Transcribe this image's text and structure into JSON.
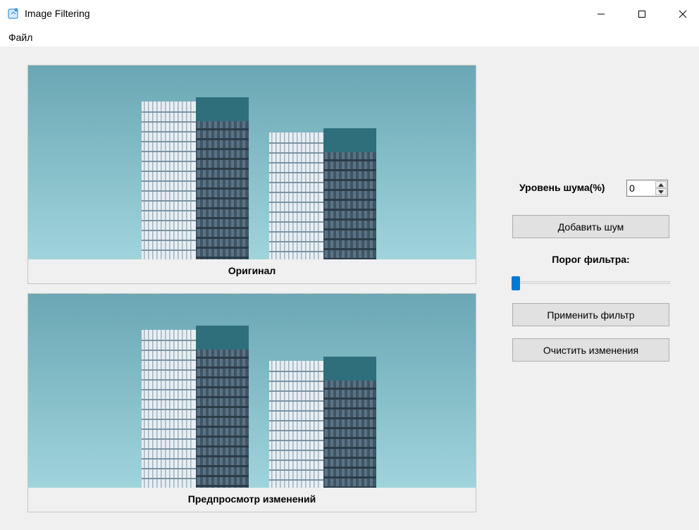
{
  "window": {
    "title": "Image Filtering",
    "icon": "app-image-icon"
  },
  "window_controls": {
    "minimize_icon": "minimize-icon",
    "maximize_icon": "maximize-icon",
    "close_icon": "close-icon"
  },
  "menu": {
    "items": [
      {
        "label": "Файл"
      }
    ]
  },
  "images": {
    "original": {
      "caption": "Оригинал"
    },
    "preview": {
      "caption": "Предпросмотр изменений"
    }
  },
  "controls": {
    "noise_label": "Уровень шума(%)",
    "noise_value": "0",
    "add_noise_button": "Добавить шум",
    "threshold_label": "Порог фильтра:",
    "threshold_value_fraction": 0.0,
    "apply_filter_button": "Применить фильтр",
    "clear_changes_button": "Очистить изменения"
  },
  "colors": {
    "accent": "#0078d7",
    "sky_top": "#6aa7b4",
    "sky_bottom": "#a0d4dc",
    "window_bg": "#f0f0f0"
  }
}
